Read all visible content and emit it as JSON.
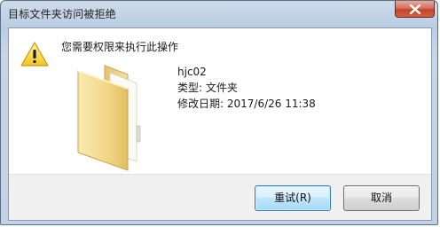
{
  "window": {
    "title": "目标文件夹访问被拒绝",
    "close_icon": "close-icon"
  },
  "dialog": {
    "message": "您需要权限来执行此操作",
    "warning_icon": "warning-icon",
    "folder_icon": "folder-icon",
    "item": {
      "name": "hjc02",
      "type": "类型: 文件夹",
      "modified": "修改日期: 2017/6/26 11:38"
    }
  },
  "buttons": {
    "retry_label": "重试(R)",
    "cancel_label": "取消"
  },
  "colors": {
    "title_bar": "#c1d2e6",
    "close_button": "#c94a32",
    "warning_yellow": "#f7d23e",
    "folder_yellow": "#f3d98a",
    "default_button_border": "#3c7fb1"
  }
}
